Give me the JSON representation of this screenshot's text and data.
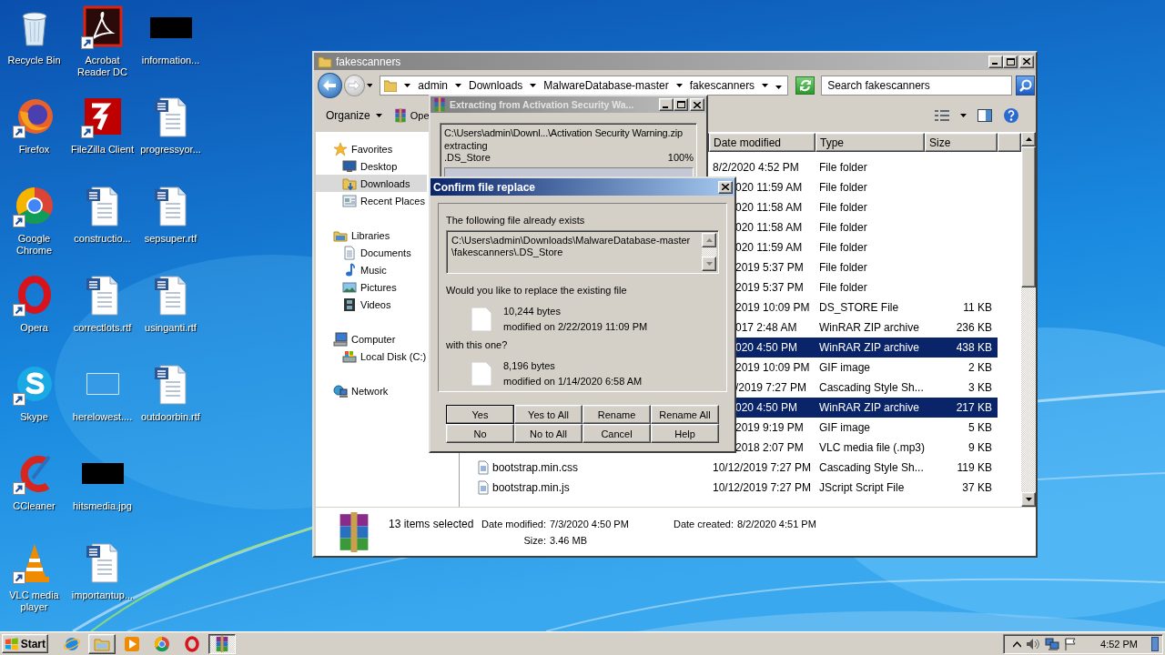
{
  "desktop": {
    "columns": [
      [
        {
          "label": "Recycle Bin",
          "shortcut": false
        },
        {
          "label": "Firefox",
          "shortcut": true
        },
        {
          "label": "Google Chrome",
          "shortcut": true
        },
        {
          "label": "Opera",
          "shortcut": true
        },
        {
          "label": "Skype",
          "shortcut": true
        },
        {
          "label": "CCleaner",
          "shortcut": true
        },
        {
          "label": "VLC media player",
          "shortcut": true
        }
      ],
      [
        {
          "label": "Acrobat Reader DC",
          "shortcut": true
        },
        {
          "label": "FileZilla Client",
          "shortcut": true
        },
        {
          "label": "constructio...",
          "shortcut": false
        },
        {
          "label": "correctlots.rtf",
          "shortcut": false
        },
        {
          "label": "herelowest....",
          "shortcut": false
        },
        {
          "label": "hitsmedia.jpg",
          "shortcut": false
        },
        {
          "label": "importantup...",
          "shortcut": false
        }
      ],
      [
        {
          "label": "information...",
          "shortcut": false
        },
        {
          "label": "progressyor...",
          "shortcut": false
        },
        {
          "label": "sepsuper.rtf",
          "shortcut": false
        },
        {
          "label": "usinganti.rtf",
          "shortcut": false
        },
        {
          "label": "outdoorbin.rtf",
          "shortcut": false
        }
      ]
    ]
  },
  "explorer": {
    "title": "fakescanners",
    "breadcrumb": [
      "admin",
      "Downloads",
      "MalwareDatabase-master",
      "fakescanners"
    ],
    "search": {
      "placeholder": "Search fakescanners"
    },
    "toolbar": [
      "Organize",
      "Ope"
    ],
    "navigation": [
      {
        "label": "Favorites",
        "selected": false,
        "children": [
          {
            "label": "Desktop",
            "selected": false
          },
          {
            "label": "Downloads",
            "selected": true
          },
          {
            "label": "Recent Places",
            "selected": false
          }
        ]
      },
      {
        "label": "Libraries",
        "selected": false,
        "children": [
          {
            "label": "Documents",
            "selected": false
          },
          {
            "label": "Music",
            "selected": false
          },
          {
            "label": "Pictures",
            "selected": false
          },
          {
            "label": "Videos",
            "selected": false
          }
        ]
      },
      {
        "label": "Computer",
        "selected": false,
        "children": [
          {
            "label": "Local Disk (C:)",
            "selected": false
          }
        ]
      },
      {
        "label": "Network",
        "selected": false
      }
    ],
    "columns": [
      "Date modified",
      "Type",
      "Size"
    ],
    "files": [
      {
        "kind": "full",
        "date_modified": "8/2/2020 4:52 PM",
        "type": "File folder",
        "selected": false
      },
      {
        "kind": "covered",
        "date_modified": "020 11:59 AM",
        "type": "File folder",
        "selected": false
      },
      {
        "kind": "covered",
        "date_modified": "020 11:58 AM",
        "type": "File folder",
        "selected": false
      },
      {
        "kind": "covered",
        "date_modified": "020 11:58 AM",
        "type": "File folder",
        "selected": false
      },
      {
        "kind": "covered",
        "date_modified": "020 11:59 AM",
        "type": "File folder",
        "selected": false
      },
      {
        "kind": "covered",
        "date_modified": "2019 5:37 PM",
        "type": "File folder",
        "selected": false
      },
      {
        "kind": "covered",
        "date_modified": "2019 5:37 PM",
        "type": "File folder",
        "selected": false
      },
      {
        "kind": "covered",
        "date_modified": "2019 10:09 PM",
        "type": "DS_STORE File",
        "size": "11 KB",
        "selected": false
      },
      {
        "kind": "covered",
        "date_modified": "017 2:48 AM",
        "type": "WinRAR ZIP archive",
        "size": "236 KB",
        "selected": false
      },
      {
        "kind": "covered",
        "date_modified": "020 4:50 PM",
        "type": "WinRAR ZIP archive",
        "size": "438 KB",
        "selected": true
      },
      {
        "kind": "covered",
        "date_modified": "2019 10:09 PM",
        "type": "GIF image",
        "size": "2 KB",
        "selected": false
      },
      {
        "kind": "covered",
        "date_modified": "/2019 7:27 PM",
        "type": "Cascading Style Sh...",
        "size": "3 KB",
        "selected": false
      },
      {
        "kind": "covered",
        "date_modified": "020 4:50 PM",
        "type": "WinRAR ZIP archive",
        "size": "217 KB",
        "selected": true
      },
      {
        "kind": "covered",
        "date_modified": "2019 9:19 PM",
        "type": "GIF image",
        "size": "5 KB",
        "selected": false
      },
      {
        "kind": "covered",
        "date_modified": "2018 2:07 PM",
        "type": "VLC media file (.mp3)",
        "size": "9 KB",
        "selected": false
      },
      {
        "kind": "full",
        "name": "bootstrap.min.css",
        "date_modified": "10/12/2019 7:27 PM",
        "type": "Cascading Style Sh...",
        "size": "119 KB",
        "selected": false
      },
      {
        "kind": "full",
        "name": "bootstrap.min.js",
        "date_modified": "10/12/2019 7:27 PM",
        "type": "JScript Script File",
        "size": "37 KB",
        "selected": false
      }
    ],
    "details": {
      "count": "13 items selected",
      "modified_label": "Date modified:",
      "modified": "7/3/2020 4:50 PM",
      "created_label": "Date created:",
      "created": "8/2/2020 4:51 PM",
      "size_label": "Size:",
      "size": "3.46 MB"
    }
  },
  "extract_window": {
    "title": "Extracting from Activation Security Wa...",
    "archive_path": "C:\\Users\\admin\\Downl...\\Activation Security Warning.zip",
    "action": "extracting",
    "file": ".DS_Store",
    "percent": "100%",
    "level": 1
  },
  "dialog": {
    "title": "Confirm file replace",
    "message": "The following file already exists",
    "path_lines": [
      "C:\\Users\\admin\\Downloads\\MalwareDatabase-master",
      "\\fakescanners\\.DS_Store"
    ],
    "question": "Would you like to replace the existing file",
    "existing": {
      "size": "10,244 bytes",
      "modified": "modified on 2/22/2019 11:09 PM"
    },
    "connector": "with this one?",
    "replacement": {
      "size": "8,196 bytes",
      "modified": "modified on 1/14/2020 6:58 AM"
    },
    "buttons": [
      {
        "label": "Yes",
        "default": true
      },
      {
        "label": "Yes to All",
        "default": false
      },
      {
        "label": "Rename",
        "default": false
      },
      {
        "label": "Rename All",
        "default": false
      },
      {
        "label": "No",
        "default": false
      },
      {
        "label": "No to All",
        "default": false
      },
      {
        "label": "Cancel",
        "default": false
      },
      {
        "label": "Help",
        "default": false
      }
    ]
  },
  "taskbar": {
    "start": "Start",
    "items": [
      {
        "kind": "launcher",
        "selected": false
      },
      {
        "kind": "task",
        "selected": false
      },
      {
        "kind": "launcher",
        "selected": false
      },
      {
        "kind": "launcher",
        "selected": false
      },
      {
        "kind": "launcher",
        "selected": false
      },
      {
        "kind": "task",
        "selected": true
      }
    ],
    "clock": "4:52 PM"
  }
}
